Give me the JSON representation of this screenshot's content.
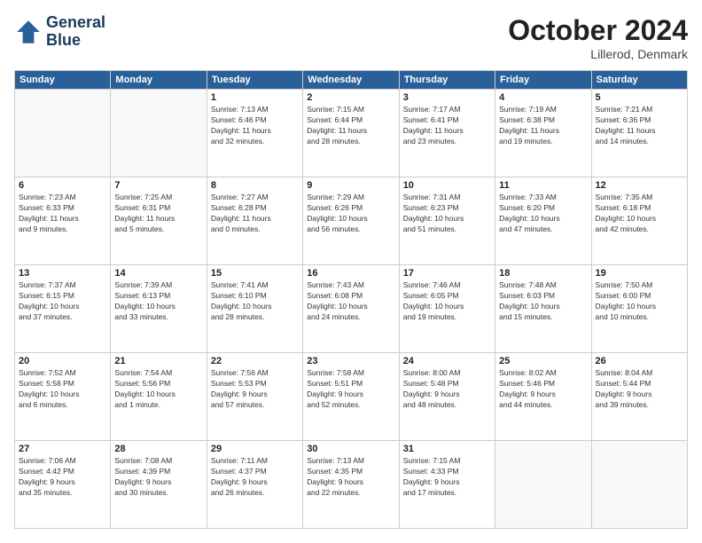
{
  "header": {
    "logo_line1": "General",
    "logo_line2": "Blue",
    "month_title": "October 2024",
    "location": "Lillerod, Denmark"
  },
  "weekdays": [
    "Sunday",
    "Monday",
    "Tuesday",
    "Wednesday",
    "Thursday",
    "Friday",
    "Saturday"
  ],
  "days": [
    {
      "num": "",
      "info": ""
    },
    {
      "num": "",
      "info": ""
    },
    {
      "num": "1",
      "info": "Sunrise: 7:13 AM\nSunset: 6:46 PM\nDaylight: 11 hours\nand 32 minutes."
    },
    {
      "num": "2",
      "info": "Sunrise: 7:15 AM\nSunset: 6:44 PM\nDaylight: 11 hours\nand 28 minutes."
    },
    {
      "num": "3",
      "info": "Sunrise: 7:17 AM\nSunset: 6:41 PM\nDaylight: 11 hours\nand 23 minutes."
    },
    {
      "num": "4",
      "info": "Sunrise: 7:19 AM\nSunset: 6:38 PM\nDaylight: 11 hours\nand 19 minutes."
    },
    {
      "num": "5",
      "info": "Sunrise: 7:21 AM\nSunset: 6:36 PM\nDaylight: 11 hours\nand 14 minutes."
    },
    {
      "num": "6",
      "info": "Sunrise: 7:23 AM\nSunset: 6:33 PM\nDaylight: 11 hours\nand 9 minutes."
    },
    {
      "num": "7",
      "info": "Sunrise: 7:25 AM\nSunset: 6:31 PM\nDaylight: 11 hours\nand 5 minutes."
    },
    {
      "num": "8",
      "info": "Sunrise: 7:27 AM\nSunset: 6:28 PM\nDaylight: 11 hours\nand 0 minutes."
    },
    {
      "num": "9",
      "info": "Sunrise: 7:29 AM\nSunset: 6:26 PM\nDaylight: 10 hours\nand 56 minutes."
    },
    {
      "num": "10",
      "info": "Sunrise: 7:31 AM\nSunset: 6:23 PM\nDaylight: 10 hours\nand 51 minutes."
    },
    {
      "num": "11",
      "info": "Sunrise: 7:33 AM\nSunset: 6:20 PM\nDaylight: 10 hours\nand 47 minutes."
    },
    {
      "num": "12",
      "info": "Sunrise: 7:35 AM\nSunset: 6:18 PM\nDaylight: 10 hours\nand 42 minutes."
    },
    {
      "num": "13",
      "info": "Sunrise: 7:37 AM\nSunset: 6:15 PM\nDaylight: 10 hours\nand 37 minutes."
    },
    {
      "num": "14",
      "info": "Sunrise: 7:39 AM\nSunset: 6:13 PM\nDaylight: 10 hours\nand 33 minutes."
    },
    {
      "num": "15",
      "info": "Sunrise: 7:41 AM\nSunset: 6:10 PM\nDaylight: 10 hours\nand 28 minutes."
    },
    {
      "num": "16",
      "info": "Sunrise: 7:43 AM\nSunset: 6:08 PM\nDaylight: 10 hours\nand 24 minutes."
    },
    {
      "num": "17",
      "info": "Sunrise: 7:46 AM\nSunset: 6:05 PM\nDaylight: 10 hours\nand 19 minutes."
    },
    {
      "num": "18",
      "info": "Sunrise: 7:48 AM\nSunset: 6:03 PM\nDaylight: 10 hours\nand 15 minutes."
    },
    {
      "num": "19",
      "info": "Sunrise: 7:50 AM\nSunset: 6:00 PM\nDaylight: 10 hours\nand 10 minutes."
    },
    {
      "num": "20",
      "info": "Sunrise: 7:52 AM\nSunset: 5:58 PM\nDaylight: 10 hours\nand 6 minutes."
    },
    {
      "num": "21",
      "info": "Sunrise: 7:54 AM\nSunset: 5:56 PM\nDaylight: 10 hours\nand 1 minute."
    },
    {
      "num": "22",
      "info": "Sunrise: 7:56 AM\nSunset: 5:53 PM\nDaylight: 9 hours\nand 57 minutes."
    },
    {
      "num": "23",
      "info": "Sunrise: 7:58 AM\nSunset: 5:51 PM\nDaylight: 9 hours\nand 52 minutes."
    },
    {
      "num": "24",
      "info": "Sunrise: 8:00 AM\nSunset: 5:48 PM\nDaylight: 9 hours\nand 48 minutes."
    },
    {
      "num": "25",
      "info": "Sunrise: 8:02 AM\nSunset: 5:46 PM\nDaylight: 9 hours\nand 44 minutes."
    },
    {
      "num": "26",
      "info": "Sunrise: 8:04 AM\nSunset: 5:44 PM\nDaylight: 9 hours\nand 39 minutes."
    },
    {
      "num": "27",
      "info": "Sunrise: 7:06 AM\nSunset: 4:42 PM\nDaylight: 9 hours\nand 35 minutes."
    },
    {
      "num": "28",
      "info": "Sunrise: 7:08 AM\nSunset: 4:39 PM\nDaylight: 9 hours\nand 30 minutes."
    },
    {
      "num": "29",
      "info": "Sunrise: 7:11 AM\nSunset: 4:37 PM\nDaylight: 9 hours\nand 26 minutes."
    },
    {
      "num": "30",
      "info": "Sunrise: 7:13 AM\nSunset: 4:35 PM\nDaylight: 9 hours\nand 22 minutes."
    },
    {
      "num": "31",
      "info": "Sunrise: 7:15 AM\nSunset: 4:33 PM\nDaylight: 9 hours\nand 17 minutes."
    },
    {
      "num": "",
      "info": ""
    },
    {
      "num": "",
      "info": ""
    }
  ]
}
